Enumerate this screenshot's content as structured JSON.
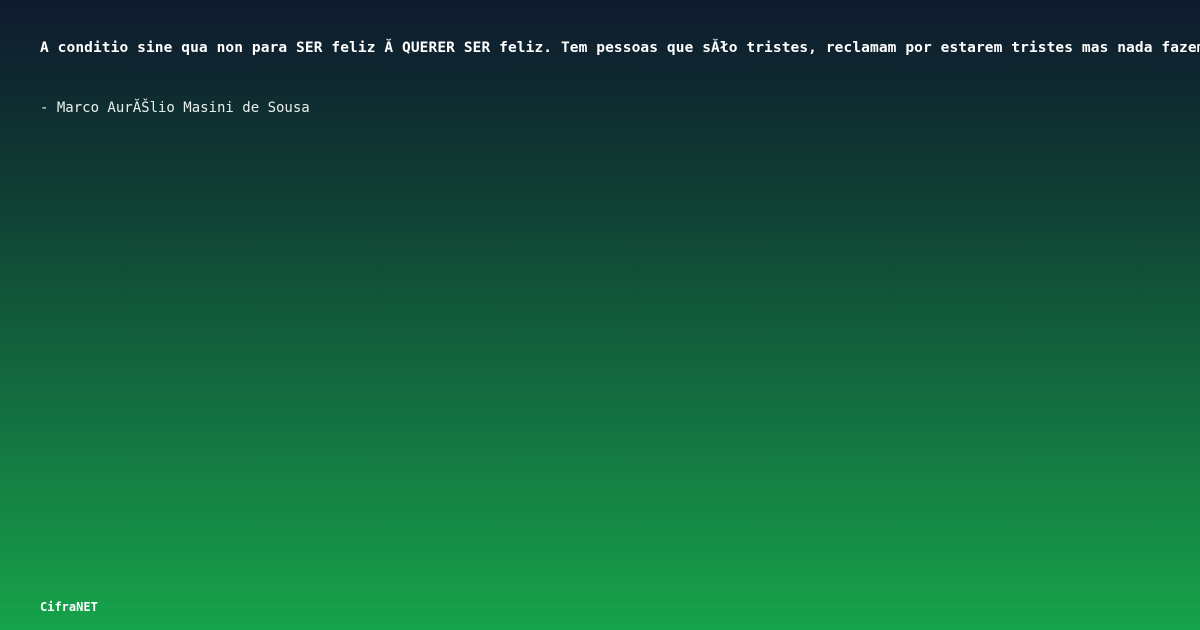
{
  "quote": {
    "text": "A conditio sine qua non para SER feliz Ă QUERER SER feliz. Tem pessoas que sĂło tristes, reclamam por estarem tristes mas nada fazem",
    "author": "- Marco AurĂŠlio Masini de Sousa"
  },
  "brand": {
    "name": "CifraNET"
  },
  "colors": {
    "gradient_top": "#0f1a2e",
    "gradient_bottom": "#16a34a",
    "text": "#ffffff"
  }
}
